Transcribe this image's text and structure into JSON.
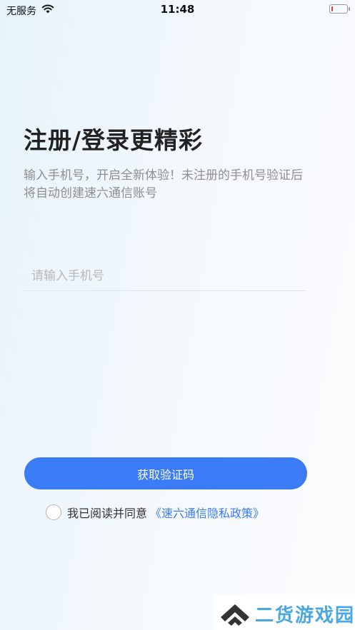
{
  "status_bar": {
    "carrier": "无服务",
    "time": "11:48",
    "battery_level": 0.1,
    "battery_color": "#e23b3b"
  },
  "login": {
    "title": "注册/登录更精彩",
    "subtitle": "输入手机号，开启全新体验！未注册的手机号验证后将自动创建速六通信账号",
    "phone_placeholder": "请输入手机号",
    "phone_value": "",
    "get_code_label": "获取验证码",
    "agreement_text": "我已阅读并同意",
    "privacy_link": "《速六通信隐私政策》",
    "agreement_checked": false
  },
  "colors": {
    "accent": "#3b7cf6",
    "title": "#222222",
    "subtitle": "#8f8f8f"
  },
  "watermark": {
    "text": "二货游戏园",
    "logo_icon": "double-chevron-up-icon"
  }
}
